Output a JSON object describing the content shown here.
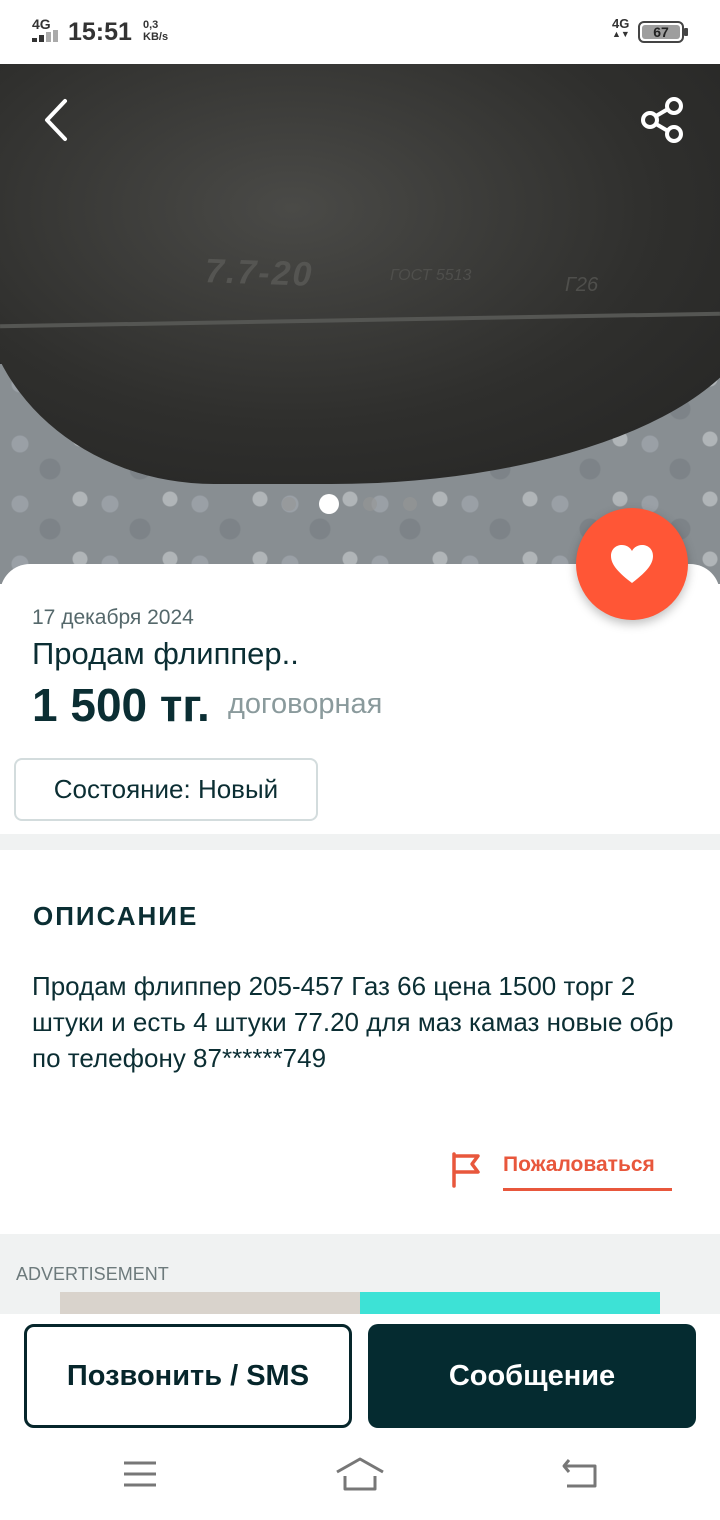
{
  "status_bar": {
    "network_left": "4G",
    "time": "15:51",
    "speed_value": "0,3",
    "speed_unit": "KB/s",
    "network_right": "4G",
    "battery": "67"
  },
  "gallery": {
    "photo_markings": [
      "7.7-20",
      "ГОСТ 5513",
      "Г26"
    ],
    "page_count": 4,
    "active_page": 2,
    "icons": [
      "back-arrow-icon",
      "share-icon",
      "heart-icon"
    ]
  },
  "listing": {
    "date": "17 декабря 2024",
    "title": "Продам флиппер..",
    "price": "1 500 тг.",
    "price_note": "договорная",
    "condition": "Состояние: Новый"
  },
  "description": {
    "heading": "ОПИСАНИЕ",
    "text": "Продам флиппер 205-457 Газ 66 цена 1500 торг 2 штуки и есть 4 штуки 77.20 для маз камаз новые обр по телефону 87******749"
  },
  "report": {
    "label": "Пожаловаться"
  },
  "advertisement": {
    "label": "ADVERTISEMENT"
  },
  "actions": {
    "call_label": "Позвонить / SMS",
    "message_label": "Сообщение"
  },
  "colors": {
    "accent": "#ff5636",
    "report": "#e8573c",
    "primary_dark": "#052b30",
    "text": "#0b2e33"
  }
}
